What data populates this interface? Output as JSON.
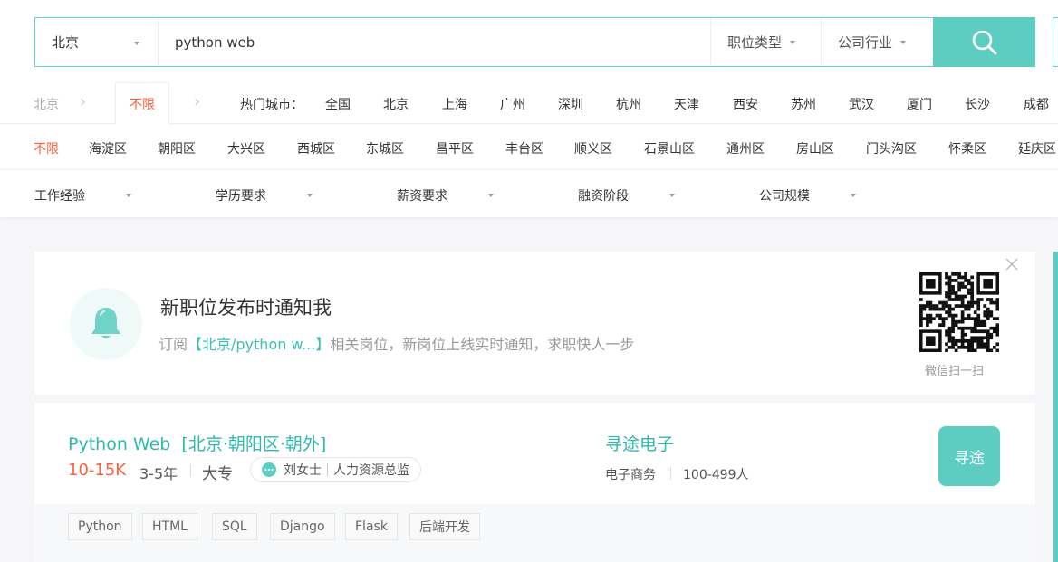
{
  "search": {
    "city": "北京",
    "query": "python web",
    "job_type_label": "职位类型",
    "industry_label": "公司行业"
  },
  "city_row": {
    "prev_crumb": "北京",
    "active_crumb": "不限",
    "hot_label": "热门城市：",
    "cities": [
      "全国",
      "北京",
      "上海",
      "广州",
      "深圳",
      "杭州",
      "天津",
      "西安",
      "苏州",
      "武汉",
      "厦门",
      "长沙",
      "成都"
    ]
  },
  "districts": {
    "active": "不限",
    "items": [
      "海淀区",
      "朝阳区",
      "大兴区",
      "西城区",
      "东城区",
      "昌平区",
      "丰台区",
      "顺义区",
      "石景山区",
      "通州区",
      "房山区",
      "门头沟区",
      "怀柔区",
      "延庆区"
    ]
  },
  "filters": [
    "工作经验",
    "学历要求",
    "薪资要求",
    "融资阶段",
    "公司规模"
  ],
  "subscribe": {
    "title": "新职位发布时通知我",
    "desc_prefix": "订阅",
    "desc_highlight": "【北京/python w...】",
    "desc_suffix": "相关岗位，新岗位上线实时通知，求职快人一步",
    "qr_caption": "微信扫一扫"
  },
  "job": {
    "title": "Python Web",
    "location": "[北京·朝阳区·朝外]",
    "salary": "10-15K",
    "experience": "3-5年",
    "education": "大专",
    "recruiter_name": "刘女士",
    "recruiter_role": "人力资源总监",
    "company_name": "寻途电子",
    "company_industry": "电子商务",
    "company_size": "100-499人",
    "company_logo_text": "寻途",
    "tags": [
      "Python",
      "HTML",
      "SQL",
      "Django",
      "Flask",
      "后端开发"
    ]
  },
  "colors": {
    "accent_teal": "#5dcdc2",
    "accent_orange": "#fd5f39",
    "link_teal": "#2fb9ab"
  },
  "icons": {
    "search": "search-icon",
    "bell": "bell-icon",
    "close": "close-icon",
    "chat": "chat-icon",
    "qr": "qr-code"
  }
}
